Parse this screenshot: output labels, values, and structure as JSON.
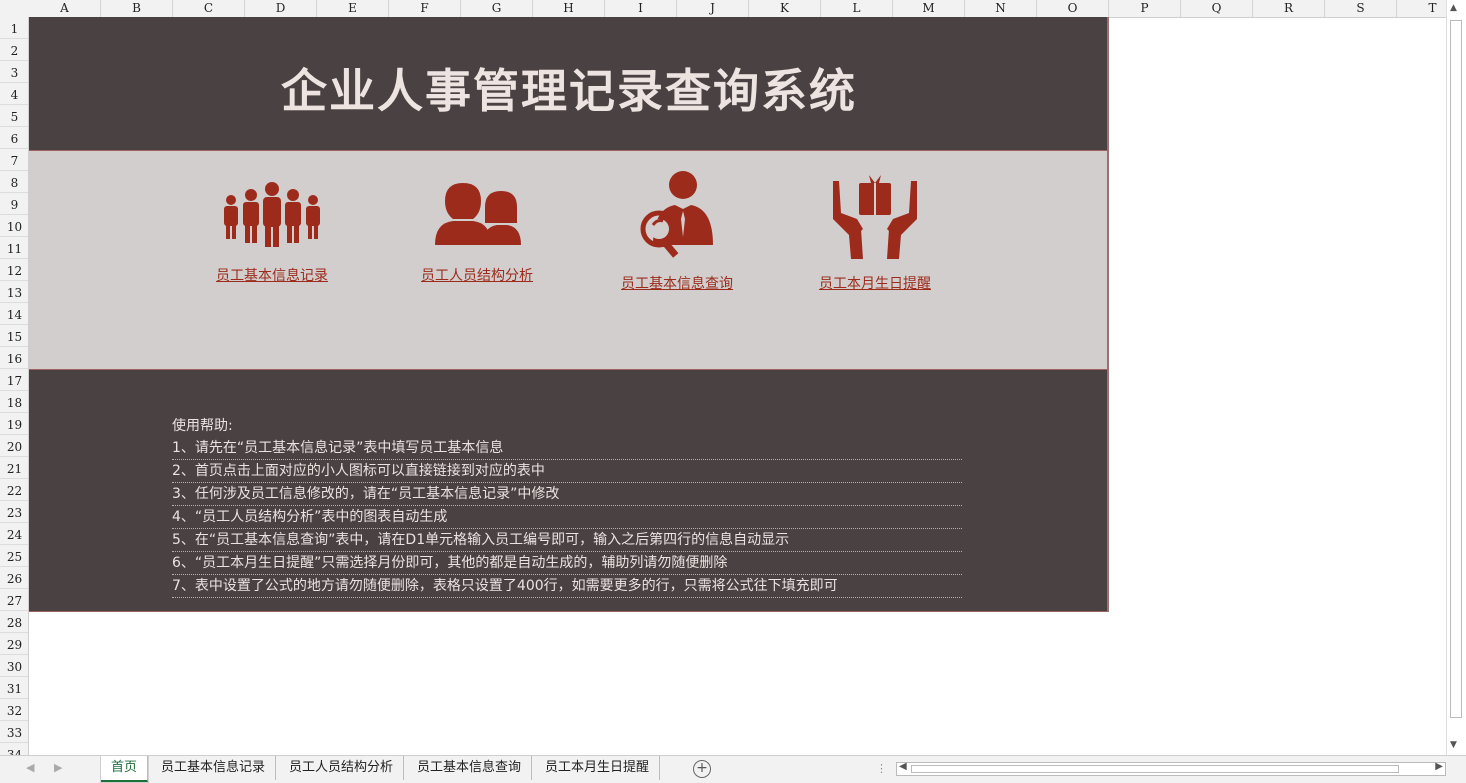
{
  "columns": [
    "A",
    "B",
    "C",
    "D",
    "E",
    "F",
    "G",
    "H",
    "I",
    "J",
    "K",
    "L",
    "M",
    "N",
    "O",
    "P",
    "Q",
    "R",
    "S",
    "T"
  ],
  "rows": [
    "1",
    "2",
    "3",
    "4",
    "5",
    "6",
    "7",
    "8",
    "9",
    "10",
    "11",
    "12",
    "13",
    "14",
    "15",
    "16",
    "17",
    "18",
    "19",
    "20",
    "21",
    "22",
    "23",
    "24",
    "25",
    "26",
    "27",
    "28",
    "29",
    "30",
    "31",
    "32",
    "33",
    "34"
  ],
  "title": "企业人事管理记录查询系统",
  "icons": [
    {
      "name": "group-people-icon",
      "label": "员工基本信息记录"
    },
    {
      "name": "couple-icon",
      "label": "员工人员结构分析"
    },
    {
      "name": "person-magnifier-icon",
      "label": "员工基本信息查询"
    },
    {
      "name": "hands-gift-icon",
      "label": "员工本月生日提醒"
    }
  ],
  "help": {
    "heading": "使用帮助:",
    "lines": [
      "1、请先在“员工基本信息记录”表中填写员工基本信息",
      "2、首页点击上面对应的小人图标可以直接链接到对应的表中",
      "3、任何涉及员工信息修改的，请在“员工基本信息记录”中修改",
      "4、“员工人员结构分析”表中的图表自动生成",
      "5、在“员工基本信息查询”表中，请在D1单元格输入员工编号即可，输入之后第四行的信息自动显示",
      "6、“员工本月生日提醒”只需选择月份即可，其他的都是自动生成的，辅助列请勿随便删除",
      "7、表中设置了公式的地方请勿随便删除，表格只设置了400行，如需要更多的行，只需将公式往下填充即可"
    ]
  },
  "sheets": [
    "首页",
    "员工基本信息记录",
    "员工人员结构分析",
    "员工基本信息查询",
    "员工本月生日提醒"
  ],
  "colors": {
    "dark": "#4a4142",
    "light": "#d2cecd",
    "accent": "#9c2b1c",
    "titleText": "#ede3e1"
  }
}
